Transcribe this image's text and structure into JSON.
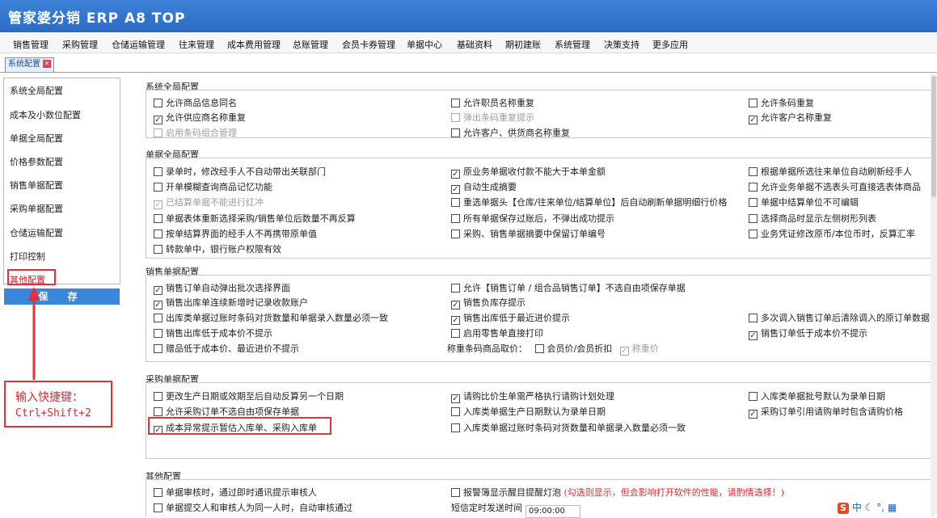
{
  "app": {
    "title": "管家婆分销 ERP A8 TOP"
  },
  "menu": [
    "销售管理",
    "采购管理",
    "仓储运输管理",
    "往来管理",
    "成本费用管理",
    "总账管理",
    "会员卡券管理",
    "单据中心",
    "基础资料",
    "期初建账",
    "系统管理",
    "决策支持",
    "更多应用"
  ],
  "tab": {
    "label": "系统配置"
  },
  "sidebar": {
    "items": [
      "系统全局配置",
      "成本及小数位配置",
      "单据全局配置",
      "价格参数配置",
      "销售单据配置",
      "采购单据配置",
      "仓储运输配置",
      "打印控制",
      "其他配置"
    ],
    "save_label": "保 存"
  },
  "annotation": {
    "line1": "输入快捷键：",
    "line2": "Ctrl+Shift+2"
  },
  "sections": [
    {
      "title": "系统全局配置"
    },
    {
      "title": "单据全局配置"
    },
    {
      "title": "销售单据配置"
    },
    {
      "title": "采购单据配置"
    },
    {
      "title": "其他配置"
    }
  ],
  "options": {
    "g1": [
      {
        "label": "允许商品信息同名",
        "checked": false,
        "disabled": false
      },
      {
        "label": "允许职员名称重复",
        "checked": false,
        "disabled": false
      },
      {
        "label": "允许条码重复",
        "checked": false,
        "disabled": false
      },
      {
        "label": "允许供应商名称重复",
        "checked": true,
        "disabled": false
      },
      {
        "label": "弹出条码重复提示",
        "checked": false,
        "disabled": true
      },
      {
        "label": "允许客户名称重复",
        "checked": true,
        "disabled": false
      },
      {
        "label": "启用条码组合管理",
        "checked": false,
        "disabled": true
      },
      {
        "label": "允许客户、供货商名称重复",
        "checked": false,
        "disabled": false
      }
    ],
    "g2": [
      {
        "label": "录单时，修改经手人不自动带出关联部门",
        "checked": false,
        "disabled": false
      },
      {
        "label": "原业务单据收付款不能大于本单金额",
        "checked": true,
        "disabled": false
      },
      {
        "label": "根据单据所选往来单位自动刷新经手人",
        "checked": false,
        "disabled": false
      },
      {
        "label": "开单模糊查询商品记忆功能",
        "checked": false,
        "disabled": false
      },
      {
        "label": "自动生成摘要",
        "checked": true,
        "disabled": false
      },
      {
        "label": "允许业务单据不选表头可直接选表体商品",
        "checked": false,
        "disabled": false
      },
      {
        "label": "已结算单据不能进行红冲",
        "checked": true,
        "disabled": true
      },
      {
        "label": "重选单据头【仓库/往来单位/结算单位】后自动刷新单据明细行价格",
        "checked": false,
        "disabled": false
      },
      {
        "label": "单据中结算单位不可编辑",
        "checked": false,
        "disabled": false
      },
      {
        "label": "单据表体重新选择采购/销售单位后数量不再反算",
        "checked": false,
        "disabled": false
      },
      {
        "label": "所有单据保存过账后，不弹出成功提示",
        "checked": false,
        "disabled": false
      },
      {
        "label": "选择商品时显示左侧树形列表",
        "checked": false,
        "disabled": false
      },
      {
        "label": "按单结算界面的经手人不再携带原单值",
        "checked": false,
        "disabled": false
      },
      {
        "label": "采购、销售单据摘要中保留订单编号",
        "checked": false,
        "disabled": false
      },
      {
        "label": "业务凭证修改原币/本位币时，反算汇率",
        "checked": false,
        "disabled": false
      },
      {
        "label": "转款单中，银行账户权限有效",
        "checked": false,
        "disabled": false
      }
    ],
    "g3": [
      {
        "label": "销售订单自动弹出批次选择界面",
        "checked": true,
        "disabled": false
      },
      {
        "label": "允许【销售订单 / 组合品销售订单】不选自由项保存单据",
        "checked": false,
        "disabled": false
      },
      {
        "label": "销售出库单连续新增时记录收款账户",
        "checked": true,
        "disabled": false
      },
      {
        "label": "销售负库存提示",
        "checked": true,
        "disabled": false
      },
      {
        "label": "出库类单据过账时条码对货数量和单据录入数量必须一致",
        "checked": false,
        "disabled": false
      },
      {
        "label": "销售出库低于最近进价提示",
        "checked": true,
        "disabled": false
      },
      {
        "label": "多次调入销售订单后清除调入的原订单数据",
        "checked": false,
        "disabled": false
      },
      {
        "label": "销售出库低于成本价不提示",
        "checked": false,
        "disabled": false
      },
      {
        "label": "启用零售单直接打印",
        "checked": false,
        "disabled": false
      },
      {
        "label": "销售订单低于成本价不提示",
        "checked": true,
        "disabled": false
      },
      {
        "label": "赠品低于成本价、最近进价不提示",
        "checked": false,
        "disabled": false
      }
    ],
    "g3_weigh": {
      "prefix": "称重条码商品取价：",
      "member": {
        "label": "会员价/会员折扣",
        "checked": false,
        "disabled": false
      },
      "weight": {
        "label": "称重价",
        "checked": true,
        "disabled": true
      }
    },
    "g4": [
      {
        "label": "更改生产日期或效期至后自动反算另一个日期",
        "checked": false,
        "disabled": false
      },
      {
        "label": "请购比价生单需严格执行请购计划处理",
        "checked": true,
        "disabled": false
      },
      {
        "label": "入库类单据批号默认为录单日期",
        "checked": false,
        "disabled": false
      },
      {
        "label": "允许采购订单不选自由项保存单据",
        "checked": false,
        "disabled": false
      },
      {
        "label": "入库类单据生产日期默认为录单日期",
        "checked": false,
        "disabled": false
      },
      {
        "label": "采购订单引用请购单时包含请购价格",
        "checked": true,
        "disabled": false
      },
      {
        "label": "成本异常提示暂估入库单、采购入库单",
        "checked": true,
        "disabled": false
      },
      {
        "label": "入库类单据过账时条码对货数量和单据录入数量必须一致",
        "checked": false,
        "disabled": false
      }
    ],
    "g5": [
      {
        "label": "单据审核时，通过即时通讯提示审核人",
        "checked": false,
        "disabled": false
      },
      {
        "label": "报警簿显示醒目提醒灯泡",
        "checked": false,
        "disabled": false
      },
      {
        "label": "单据提交人和审核人为同一人时，自动审核通过",
        "checked": false,
        "disabled": false
      }
    ],
    "g5_extra": {
      "warn": "(勾选则显示，但会影响打开软件的性能，请酌情选择！)",
      "sms_label": "短信定时发送时间",
      "sms_time": "09:00:00"
    }
  },
  "tray": {
    "label": "中"
  }
}
